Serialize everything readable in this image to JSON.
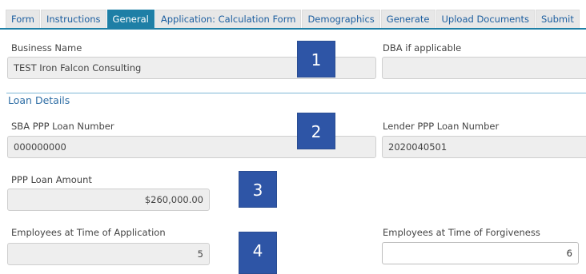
{
  "tabs": [
    "Form",
    "Instructions",
    "General",
    "Application: Calculation Form",
    "Demographics",
    "Generate",
    "Upload Documents",
    "Submit"
  ],
  "active_tab": "General",
  "business": {
    "name_label": "Business Name",
    "name_value": "TEST Iron Falcon Consulting",
    "dba_label": "DBA if applicable",
    "dba_value": ""
  },
  "loan_details": {
    "section_title": "Loan Details",
    "sba_label": "SBA PPP Loan Number",
    "sba_value": "000000000",
    "lender_label": "Lender PPP Loan Number",
    "lender_value": "2020040501",
    "amount_label": "PPP Loan Amount",
    "amount_value": "$260,000.00",
    "emp_app_label": "Employees at Time of Application",
    "emp_app_value": "5",
    "emp_forg_label": "Employees at Time of Forgiveness",
    "emp_forg_value": "6"
  },
  "annotations": [
    "1",
    "2",
    "3",
    "4"
  ],
  "colors": {
    "active_tab": "#1e7fa6",
    "annotation_box": "#2e55a6",
    "link_text": "#1d5fa0"
  }
}
